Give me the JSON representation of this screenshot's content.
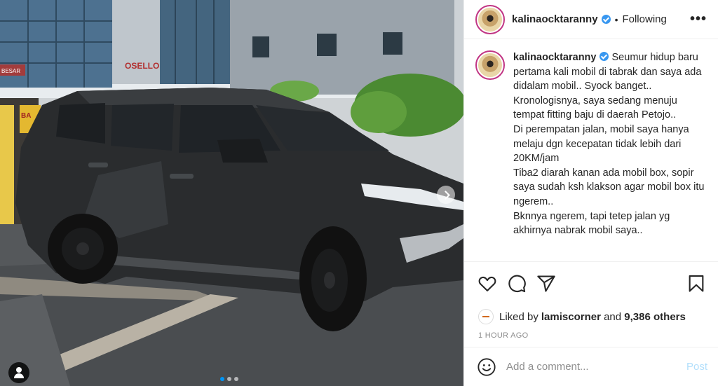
{
  "header": {
    "username": "kalinaocktaranny",
    "separator": "•",
    "follow_label": "Following",
    "more_label": "•••"
  },
  "caption": {
    "username": "kalinaocktaranny",
    "text": " Seumur hidup baru pertama kali mobil di tabrak dan saya ada didalam mobil.. Syock banget.. Kronologisnya, saya sedang menuju tempat fitting baju di daerah Petojo..\nDi perempatan jalan, mobil saya hanya melaju dgn kecepatan tidak lebih dari 20KM/jam\nTiba2 diarah kanan ada mobil box, sopir saya sudah ksh klakson agar mobil box itu ngerem..\nBknnya ngerem, tapi tetep jalan yg akhirnya nabrak mobil saya.."
  },
  "likes": {
    "prefix": "Liked by ",
    "user": "lamiscorner",
    "middle": " and ",
    "count": "9,386 others"
  },
  "timestamp": "1 HOUR AGO",
  "comment": {
    "placeholder": "Add a comment...",
    "post_label": "Post"
  },
  "photo": {
    "signs": [
      "OSELLO",
      "BESAR",
      "BA"
    ],
    "carousel": {
      "count": 3,
      "active": 1
    }
  },
  "icons": [
    "heart-icon",
    "comment-icon",
    "share-icon",
    "bookmark-icon",
    "emoji-icon",
    "verified-badge-icon",
    "user-tag-icon",
    "carousel-next-icon"
  ],
  "colors": {
    "accent": "#0095f6",
    "verified": "#3897f0",
    "post_disabled": "#b2dffc",
    "meta": "#8e8e8e"
  }
}
